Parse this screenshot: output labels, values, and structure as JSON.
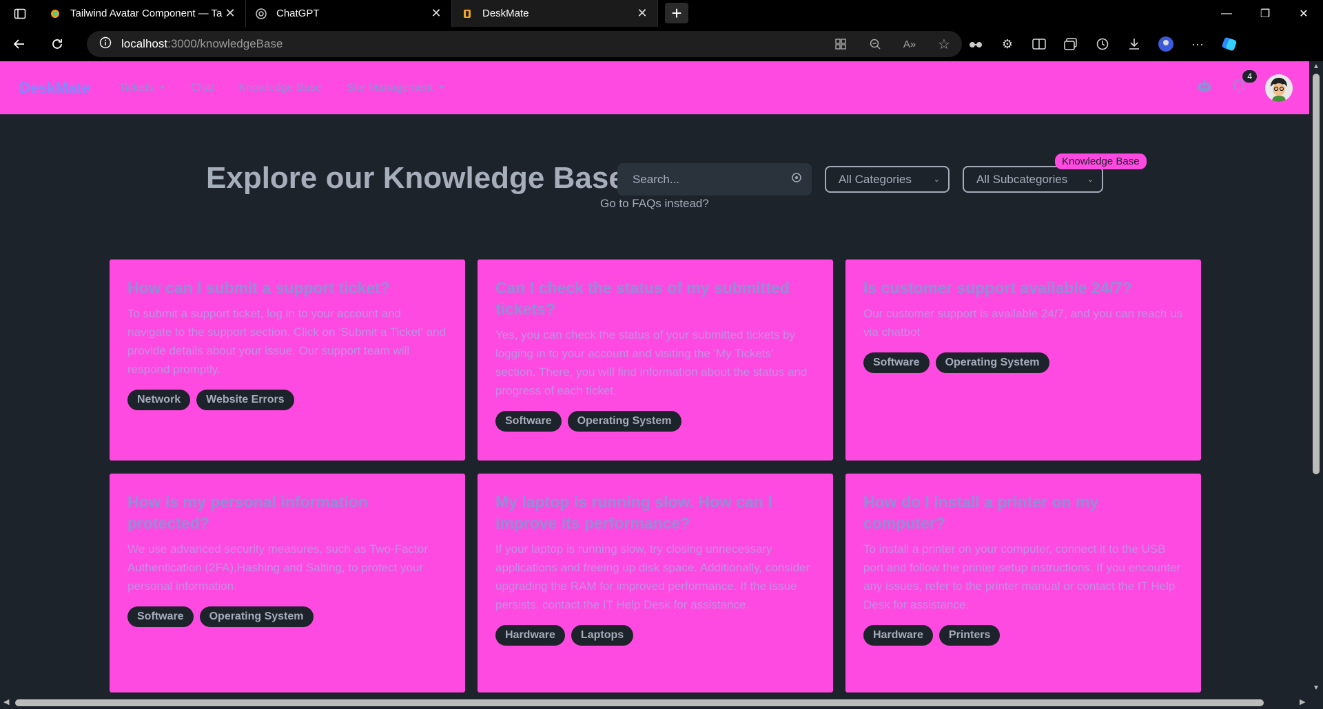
{
  "browser": {
    "tabs": [
      {
        "title": "Tailwind Avatar Component — Ta",
        "icon": "tailwind-favicon"
      },
      {
        "title": "ChatGPT",
        "icon": "chatgpt-favicon"
      },
      {
        "title": "DeskMate",
        "icon": "deskmate-favicon"
      }
    ],
    "url_host": "localhost",
    "url_path": ":3000/knowledgeBase"
  },
  "nav": {
    "brand": "DeskMate",
    "items": [
      "Tickets",
      "Chat",
      "Knowledge Base",
      "Site Management"
    ],
    "notification_count": "4"
  },
  "header": {
    "title": "Explore our Knowledge Base",
    "search_placeholder": "Search...",
    "category_select": "All Categories",
    "subcategory_select": "All Subcategories",
    "tooltip": "Knowledge Base",
    "faq_link": "Go to FAQs instead?"
  },
  "cards": [
    {
      "title": "How can I submit a support ticket?",
      "body": "To submit a support ticket, log in to your account and navigate to the support section. Click on 'Submit a Ticket' and provide details about your issue. Our support team will respond promptly.",
      "tags": [
        "Network",
        "Website Errors"
      ]
    },
    {
      "title": "Can I check the status of my submitted tickets?",
      "body": "Yes, you can check the status of your submitted tickets by logging in to your account and visiting the 'My Tickets' section. There, you will find information about the status and progress of each ticket.",
      "tags": [
        "Software",
        "Operating System"
      ]
    },
    {
      "title": "Is customer support available 24/7?",
      "body": "Our customer support is available 24/7, and you can reach us via chatbot",
      "tags": [
        "Software",
        "Operating System"
      ]
    },
    {
      "title": "How is my personal information protected?",
      "body": "We use advanced security measures, such as Two-Factor Authentication (2FA),Hashing and Salting, to protect your personal information.",
      "tags": [
        "Software",
        "Operating System"
      ]
    },
    {
      "title": "My laptop is running slow. How can I improve its performance?",
      "body": "If your laptop is running slow, try closing unnecessary applications and freeing up disk space. Additionally, consider upgrading the RAM for improved performance. If the issue persists, contact the IT Help Desk for assistance.",
      "tags": [
        "Hardware",
        "Laptops"
      ]
    },
    {
      "title": "How do I install a printer on my computer?",
      "body": "To install a printer on your computer, connect it to the USB port and follow the printer setup instructions. If you encounter any issues, refer to the printer manual or contact the IT Help Desk for assistance.",
      "tags": [
        "Hardware",
        "Printers"
      ]
    }
  ]
}
